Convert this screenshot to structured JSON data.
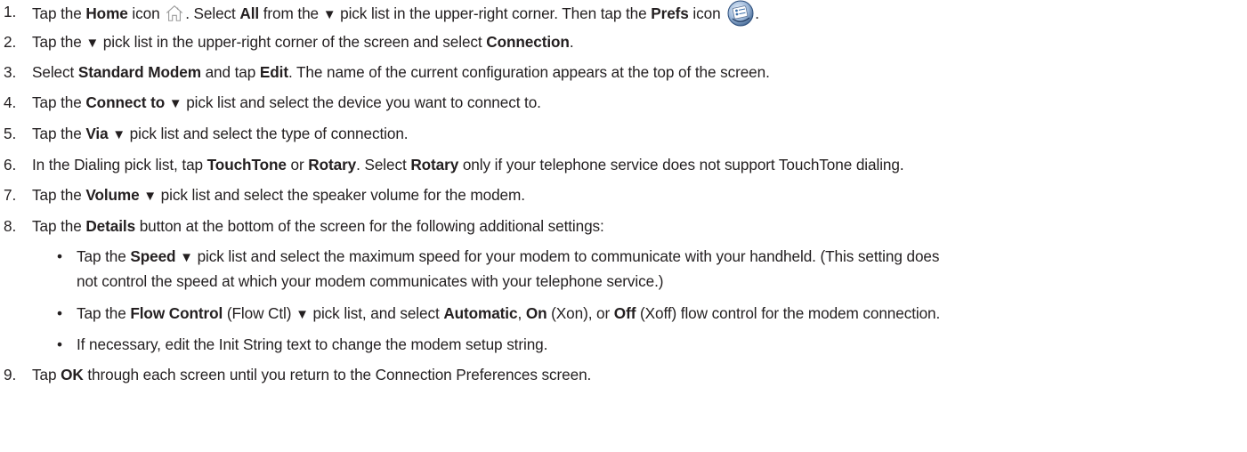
{
  "steps": [
    {
      "n": "1.",
      "parts": [
        {
          "t": "Tap the "
        },
        {
          "b": "Home"
        },
        {
          "t": " icon "
        },
        {
          "icon": "home-icon"
        },
        {
          "t": ". Select "
        },
        {
          "b": "All"
        },
        {
          "t": " from the "
        },
        {
          "tri": "▼"
        },
        {
          "t": " pick list in the upper-right corner. Then tap the "
        },
        {
          "b": "Prefs"
        },
        {
          "t": " icon "
        },
        {
          "icon": "prefs-icon"
        },
        {
          "t": "."
        }
      ]
    },
    {
      "n": "2.",
      "parts": [
        {
          "t": "Tap the "
        },
        {
          "tri": "▼"
        },
        {
          "t": " pick list in the upper-right corner of the screen and select "
        },
        {
          "b": "Connection"
        },
        {
          "t": "."
        }
      ]
    },
    {
      "n": "3.",
      "parts": [
        {
          "t": "Select "
        },
        {
          "b": "Standard Modem"
        },
        {
          "t": " and tap "
        },
        {
          "b": "Edit"
        },
        {
          "t": ". The name of the current configuration appears at the top of the screen."
        }
      ]
    },
    {
      "n": "4.",
      "parts": [
        {
          "t": "Tap the "
        },
        {
          "b": "Connect to"
        },
        {
          "t": " "
        },
        {
          "tri": "▼"
        },
        {
          "t": " pick list and select the device you want to connect to."
        }
      ]
    },
    {
      "n": "5.",
      "parts": [
        {
          "t": "Tap the "
        },
        {
          "b": "Via"
        },
        {
          "t": " "
        },
        {
          "tri": "▼"
        },
        {
          "t": " pick list and select the type of connection."
        }
      ]
    },
    {
      "n": "6.",
      "parts": [
        {
          "t": "In the Dialing pick list, tap "
        },
        {
          "b": "TouchTone"
        },
        {
          "t": " or "
        },
        {
          "b": "Rotary"
        },
        {
          "t": ". Select "
        },
        {
          "b": "Rotary"
        },
        {
          "t": " only if your telephone service does not support TouchTone dialing."
        }
      ]
    },
    {
      "n": "7.",
      "parts": [
        {
          "t": "Tap the "
        },
        {
          "b": "Volume"
        },
        {
          "t": " "
        },
        {
          "tri": "▼"
        },
        {
          "t": " pick list and select the speaker volume for the modem."
        }
      ]
    },
    {
      "n": "8.",
      "parts": [
        {
          "t": "Tap the "
        },
        {
          "b": "Details"
        },
        {
          "t": " button at the bottom of the screen for the following additional settings:"
        }
      ]
    }
  ],
  "bullets": [
    {
      "lines": [
        [
          {
            "t": "Tap the "
          },
          {
            "b": "Speed"
          },
          {
            "t": " "
          },
          {
            "tri": "▼"
          },
          {
            "t": " pick list and select the maximum speed for your modem to communicate with your handheld. (This setting does"
          }
        ],
        [
          {
            "t": "not control the speed at which your modem communicates with your telephone service.)"
          }
        ]
      ]
    },
    {
      "lines": [
        [
          {
            "t": "Tap the "
          },
          {
            "b": "Flow Control"
          },
          {
            "t": " (Flow Ctl) "
          },
          {
            "tri": "▼"
          },
          {
            "t": " pick list, and select "
          },
          {
            "b": "Automatic"
          },
          {
            "t": ", "
          },
          {
            "b": "On"
          },
          {
            "t": " (Xon), or "
          },
          {
            "b": "Off"
          },
          {
            "t": " (Xoff) flow control for the modem connection."
          }
        ]
      ]
    },
    {
      "lines": [
        [
          {
            "t": "If necessary, edit the Init String text to change the modem setup string."
          }
        ]
      ]
    }
  ],
  "last_step": {
    "n": "9.",
    "parts": [
      {
        "t": "Tap "
      },
      {
        "b": "OK"
      },
      {
        "t": " through each screen until you return to the Connection Preferences screen."
      }
    ]
  },
  "bullet_char": "•"
}
